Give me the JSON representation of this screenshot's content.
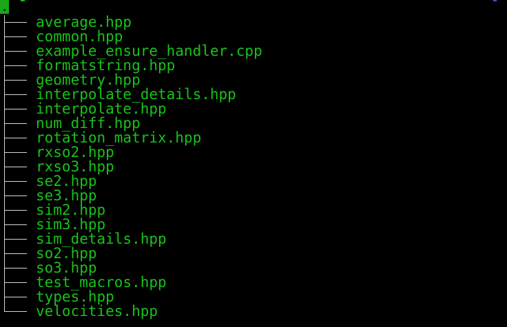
{
  "terminal": {
    "files": [
      "average.hpp",
      "common.hpp",
      "example_ensure_handler.cpp",
      "formatstring.hpp",
      "geometry.hpp",
      "interpolate_details.hpp",
      "interpolate.hpp",
      "num_diff.hpp",
      "rotation_matrix.hpp",
      "rxso2.hpp",
      "rxso3.hpp",
      "se2.hpp",
      "se3.hpp",
      "sim2.hpp",
      "sim3.hpp",
      "sim_details.hpp",
      "so2.hpp",
      "so3.hpp",
      "test_macros.hpp",
      "types.hpp",
      "velocities.hpp"
    ],
    "colors": {
      "background": "#000000",
      "filename": "#19c21a",
      "tree_lines": "#d8d8d8",
      "cursor": "#1aa71a"
    }
  }
}
